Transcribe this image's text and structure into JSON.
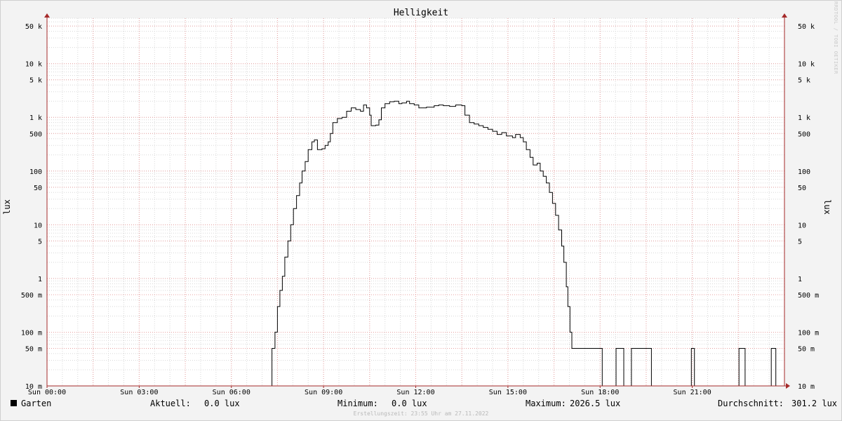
{
  "chart_data": {
    "type": "line",
    "title": "Helligkeit",
    "ylabel": "lux",
    "yscale": "log",
    "ylim": [
      0.01,
      70000
    ],
    "xlim": [
      0,
      24
    ],
    "grid": true,
    "x_ticks": [
      {
        "hour": 0,
        "label": "Sun 00:00"
      },
      {
        "hour": 3,
        "label": "Sun 03:00"
      },
      {
        "hour": 6,
        "label": "Sun 06:00"
      },
      {
        "hour": 9,
        "label": "Sun 09:00"
      },
      {
        "hour": 12,
        "label": "Sun 12:00"
      },
      {
        "hour": 15,
        "label": "Sun 15:00"
      },
      {
        "hour": 18,
        "label": "Sun 18:00"
      },
      {
        "hour": 21,
        "label": "Sun 21:00"
      }
    ],
    "y_ticks": [
      {
        "value": 0.01,
        "label": "10 m"
      },
      {
        "value": 0.05,
        "label": "50 m"
      },
      {
        "value": 0.1,
        "label": "100 m"
      },
      {
        "value": 0.5,
        "label": "500 m"
      },
      {
        "value": 1,
        "label": "1"
      },
      {
        "value": 5,
        "label": "5"
      },
      {
        "value": 10,
        "label": "10"
      },
      {
        "value": 50,
        "label": "50"
      },
      {
        "value": 100,
        "label": "100"
      },
      {
        "value": 500,
        "label": "500"
      },
      {
        "value": 1000,
        "label": "1 k"
      },
      {
        "value": 5000,
        "label": "5 k"
      },
      {
        "value": 10000,
        "label": "10 k"
      },
      {
        "value": 50000,
        "label": "50 k"
      }
    ],
    "series": [
      {
        "name": "Garten",
        "color": "#000000",
        "points": [
          [
            0,
            0.01
          ],
          [
            7.3,
            0.01
          ],
          [
            7.32,
            0.05
          ],
          [
            7.42,
            0.1
          ],
          [
            7.5,
            0.3
          ],
          [
            7.58,
            0.6
          ],
          [
            7.66,
            1.1
          ],
          [
            7.74,
            2.5
          ],
          [
            7.84,
            5
          ],
          [
            7.93,
            10
          ],
          [
            8.02,
            20
          ],
          [
            8.12,
            35
          ],
          [
            8.22,
            60
          ],
          [
            8.3,
            100
          ],
          [
            8.4,
            150
          ],
          [
            8.5,
            250
          ],
          [
            8.62,
            350
          ],
          [
            8.7,
            380
          ],
          [
            8.8,
            250
          ],
          [
            8.95,
            260
          ],
          [
            9.05,
            300
          ],
          [
            9.15,
            350
          ],
          [
            9.22,
            500
          ],
          [
            9.3,
            800
          ],
          [
            9.45,
            950
          ],
          [
            9.6,
            1000
          ],
          [
            9.75,
            1300
          ],
          [
            9.9,
            1500
          ],
          [
            10.05,
            1400
          ],
          [
            10.2,
            1300
          ],
          [
            10.3,
            1700
          ],
          [
            10.4,
            1500
          ],
          [
            10.5,
            1100
          ],
          [
            10.55,
            700
          ],
          [
            10.7,
            720
          ],
          [
            10.8,
            900
          ],
          [
            10.88,
            1500
          ],
          [
            11.0,
            1800
          ],
          [
            11.15,
            1950
          ],
          [
            11.3,
            2000
          ],
          [
            11.45,
            1800
          ],
          [
            11.55,
            1850
          ],
          [
            11.7,
            2000
          ],
          [
            11.8,
            1800
          ],
          [
            11.95,
            1700
          ],
          [
            12.1,
            1500
          ],
          [
            12.35,
            1550
          ],
          [
            12.6,
            1650
          ],
          [
            12.75,
            1700
          ],
          [
            12.9,
            1650
          ],
          [
            13.1,
            1600
          ],
          [
            13.3,
            1700
          ],
          [
            13.5,
            1650
          ],
          [
            13.6,
            1100
          ],
          [
            13.75,
            800
          ],
          [
            13.9,
            750
          ],
          [
            14.05,
            700
          ],
          [
            14.2,
            650
          ],
          [
            14.35,
            600
          ],
          [
            14.5,
            550
          ],
          [
            14.65,
            480
          ],
          [
            14.8,
            520
          ],
          [
            14.95,
            450
          ],
          [
            15.15,
            420
          ],
          [
            15.25,
            480
          ],
          [
            15.4,
            420
          ],
          [
            15.5,
            350
          ],
          [
            15.6,
            250
          ],
          [
            15.72,
            180
          ],
          [
            15.82,
            130
          ],
          [
            15.95,
            140
          ],
          [
            16.05,
            100
          ],
          [
            16.15,
            80
          ],
          [
            16.25,
            60
          ],
          [
            16.35,
            40
          ],
          [
            16.45,
            25
          ],
          [
            16.55,
            15
          ],
          [
            16.65,
            8
          ],
          [
            16.75,
            4
          ],
          [
            16.82,
            2
          ],
          [
            16.9,
            0.7
          ],
          [
            16.95,
            0.3
          ],
          [
            17.02,
            0.1
          ],
          [
            17.08,
            0.05
          ],
          [
            17.15,
            0.05
          ],
          [
            18.05,
            0.05
          ],
          [
            18.07,
            0.01
          ],
          [
            18.5,
            0.01
          ],
          [
            18.52,
            0.05
          ],
          [
            18.75,
            0.05
          ],
          [
            18.77,
            0.01
          ],
          [
            19.0,
            0.01
          ],
          [
            19.02,
            0.05
          ],
          [
            19.65,
            0.05
          ],
          [
            19.67,
            0.01
          ],
          [
            20.95,
            0.01
          ],
          [
            20.97,
            0.05
          ],
          [
            21.05,
            0.05
          ],
          [
            21.07,
            0.01
          ],
          [
            22.5,
            0.01
          ],
          [
            22.52,
            0.05
          ],
          [
            22.7,
            0.05
          ],
          [
            22.72,
            0.01
          ],
          [
            23.55,
            0.01
          ],
          [
            23.57,
            0.05
          ],
          [
            23.7,
            0.05
          ],
          [
            23.72,
            0.01
          ],
          [
            24,
            0.01
          ]
        ]
      }
    ],
    "stats": {
      "series_label": "Garten",
      "current_label": "Aktuell:",
      "current_value": "0.0 lux",
      "min_label": "Minimum:",
      "min_value": "0.0 lux",
      "max_label": "Maximum:",
      "max_value": "2026.5 lux",
      "avg_label": "Durchschnitt:",
      "avg_value": "301.2 lux"
    }
  },
  "watermark": "RRDTOOL / TOBI OETIKER",
  "footer": "Erstellungszeit: 23:55 Uhr am 27.11.2022",
  "colors": {
    "background": "#f3f3f3",
    "plot_background": "#ffffff",
    "major_grid": "#e8a0a0",
    "minor_grid": "#d8d8d8",
    "axis": "#a52a2a",
    "line": "#000000"
  }
}
